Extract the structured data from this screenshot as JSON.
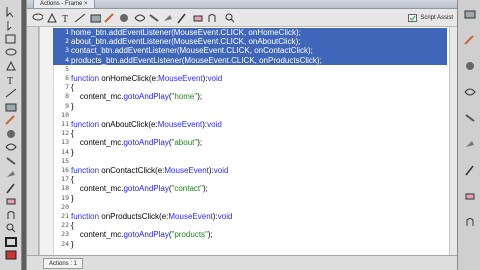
{
  "window": {
    "tab_title": "Actions - Frame ×"
  },
  "toolbar": {
    "script_assist_label": "Script Assist"
  },
  "code_lines": [
    {
      "num": "1",
      "text": "home_btn.addEventListener(MouseEvent.CLICK, onHomeClick);",
      "selected": true
    },
    {
      "num": "2",
      "text": "about_btn.addEventListener(MouseEvent.CLICK, onAboutClick);",
      "selected": true
    },
    {
      "num": "3",
      "text": "contact_btn.addEventListener(MouseEvent.CLICK, onContactClick);",
      "selected": true
    },
    {
      "num": "4",
      "text": "products_btn.addEventListener(MouseEvent.CLICK, onProductsClick);",
      "selected": true
    },
    {
      "num": "5",
      "text": "",
      "selected": false
    },
    {
      "num": "6",
      "text": "function onHomeClick(e:MouseEvent):void",
      "selected": false
    },
    {
      "num": "7",
      "text": "{",
      "selected": false
    },
    {
      "num": "8",
      "text": "    content_mc.gotoAndPlay(\"home\");",
      "selected": false
    },
    {
      "num": "9",
      "text": "}",
      "selected": false
    },
    {
      "num": "10",
      "text": "",
      "selected": false
    },
    {
      "num": "11",
      "text": "function onAboutClick(e:MouseEvent):void",
      "selected": false
    },
    {
      "num": "12",
      "text": "{",
      "selected": false
    },
    {
      "num": "13",
      "text": "    content_mc.gotoAndPlay(\"about\");",
      "selected": false
    },
    {
      "num": "14",
      "text": "}",
      "selected": false
    },
    {
      "num": "15",
      "text": "",
      "selected": false
    },
    {
      "num": "16",
      "text": "function onContactClick(e:MouseEvent):void",
      "selected": false
    },
    {
      "num": "17",
      "text": "{",
      "selected": false
    },
    {
      "num": "18",
      "text": "    content_mc.gotoAndPlay(\"contact\");",
      "selected": false
    },
    {
      "num": "19",
      "text": "}",
      "selected": false
    },
    {
      "num": "20",
      "text": "",
      "selected": false
    },
    {
      "num": "21",
      "text": "function onProductsClick(e:MouseEvent):void",
      "selected": false
    },
    {
      "num": "22",
      "text": "{",
      "selected": false
    },
    {
      "num": "23",
      "text": "    content_mc.gotoAndPlay(\"products\");",
      "selected": false
    },
    {
      "num": "24",
      "text": "}",
      "selected": false
    }
  ],
  "bottom": {
    "tab_label": "Actions : 1",
    "status": ""
  },
  "colors": {
    "selection": "#3f66b8",
    "keyword": "#2a2aff",
    "string": "#1a8a1a"
  },
  "icons": {
    "tools": [
      "selection-icon",
      "subselection-icon",
      "free-transform-icon",
      "lasso-icon",
      "pen-icon",
      "text-icon",
      "line-icon",
      "rectangle-icon",
      "pencil-icon",
      "brush-icon",
      "deco-icon",
      "bone-icon",
      "paint-bucket-icon",
      "eyedropper-icon",
      "eraser-icon",
      "hand-icon",
      "zoom-icon",
      "stroke-color-icon",
      "fill-color-icon"
    ],
    "toolbar": [
      "add-statement-icon",
      "find-icon",
      "insert-target-icon",
      "check-syntax-icon",
      "auto-format-icon",
      "code-hint-icon",
      "debug-options-icon",
      "collapse-icon",
      "expand-icon",
      "comment-icon",
      "uncomment-icon",
      "show-toolbox-icon",
      "help-icon",
      "panel-menu-icon"
    ],
    "right": [
      "color-panel-icon",
      "swatches-icon",
      "align-icon",
      "info-icon",
      "transform-icon",
      "library-icon",
      "components-icon",
      "motion-presets-icon",
      "properties-icon"
    ]
  }
}
